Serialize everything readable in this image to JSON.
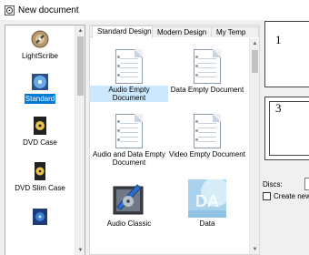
{
  "window": {
    "title": "New document",
    "icon": "app-disc-icon"
  },
  "categories": [
    {
      "label": "LightScribe",
      "icon": "lightscribe-icon",
      "selected": false
    },
    {
      "label": "Standard",
      "icon": "standard-disc-icon",
      "selected": true
    },
    {
      "label": "DVD Case",
      "icon": "dvd-case-icon",
      "selected": false
    },
    {
      "label": "DVD Slim Case",
      "icon": "dvd-slim-case-icon",
      "selected": false
    },
    {
      "label": "",
      "icon": "partial-category-icon",
      "selected": false
    }
  ],
  "tabs": [
    {
      "label": "Standard Design",
      "active": true
    },
    {
      "label": "Modern Design",
      "active": false
    },
    {
      "label": "My Temp",
      "active": false
    }
  ],
  "templates": [
    {
      "label": "Audio Empty Document",
      "icon": "document-icon",
      "selected": true
    },
    {
      "label": "Data Empty Document",
      "icon": "document-icon",
      "selected": false
    },
    {
      "label": "Audio and Data Empty Document",
      "icon": "document-icon",
      "selected": false
    },
    {
      "label": "Video Empty Document",
      "icon": "document-icon",
      "selected": false
    },
    {
      "label": "Audio Classic",
      "icon": "audio-classic-icon",
      "selected": false
    },
    {
      "label": "Data",
      "icon": "data-template-icon",
      "selected": false
    }
  ],
  "preview": {
    "page_numbers": [
      "1",
      "3"
    ],
    "discs_label": "Discs:",
    "create_new_label": "Create new t"
  },
  "colors": {
    "selection": "#0078d7",
    "selection_light": "#cce8ff"
  }
}
